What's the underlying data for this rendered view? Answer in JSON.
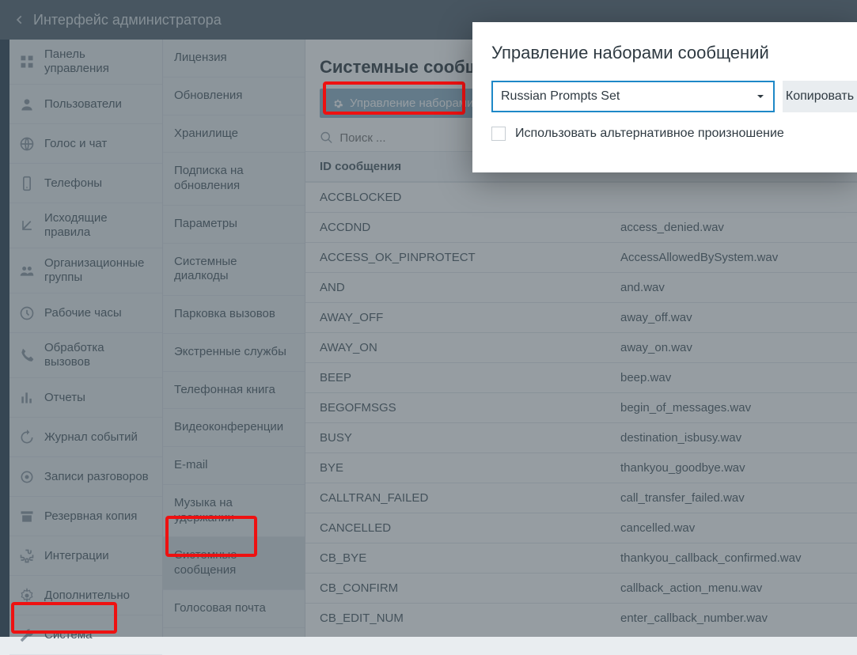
{
  "header": {
    "title": "Интерфейс администратора"
  },
  "nav1": [
    {
      "icon": "dashboard",
      "label": "Панель управления"
    },
    {
      "icon": "user",
      "label": "Пользователи"
    },
    {
      "icon": "globe",
      "label": "Голос и чат"
    },
    {
      "icon": "phone-device",
      "label": "Телефоны"
    },
    {
      "icon": "outbound",
      "label": "Исходящие правила"
    },
    {
      "icon": "group",
      "label": "Организационные группы"
    },
    {
      "icon": "clock",
      "label": "Рабочие часы"
    },
    {
      "icon": "phone",
      "label": "Обработка вызовов"
    },
    {
      "icon": "report",
      "label": "Отчеты"
    },
    {
      "icon": "history",
      "label": "Журнал событий"
    },
    {
      "icon": "record",
      "label": "Записи разговоров"
    },
    {
      "icon": "archive",
      "label": "Резервная копия"
    },
    {
      "icon": "puzzle",
      "label": "Интеграции"
    },
    {
      "icon": "gear",
      "label": "Дополнительно"
    },
    {
      "icon": "wrench",
      "label": "Система"
    }
  ],
  "nav2": [
    "Лицензия",
    "Обновления",
    "Хранилище",
    "Подписка на обновления",
    "Параметры",
    "Системные диалкоды",
    "Парковка вызовов",
    "Экстренные службы",
    "Телефонная книга",
    "Видеоконференции",
    "E-mail",
    "Музыка на удержании",
    "Системные сообщения",
    "Голосовая почта"
  ],
  "nav2_active_index": 12,
  "main": {
    "title": "Системные сообщения",
    "manage_button": "Управление наборами",
    "search_placeholder": "Поиск ...",
    "columns": [
      "ID сообщения",
      ""
    ],
    "rows": [
      {
        "id": "ACCBLOCKED",
        "file": ""
      },
      {
        "id": "ACCDND",
        "file": "access_denied.wav"
      },
      {
        "id": "ACCESS_OK_PINPROTECT",
        "file": "AccessAllowedBySystem.wav"
      },
      {
        "id": "AND",
        "file": "and.wav"
      },
      {
        "id": "AWAY_OFF",
        "file": "away_off.wav"
      },
      {
        "id": "AWAY_ON",
        "file": "away_on.wav"
      },
      {
        "id": "BEEP",
        "file": "beep.wav"
      },
      {
        "id": "BEGOFMSGS",
        "file": "begin_of_messages.wav"
      },
      {
        "id": "BUSY",
        "file": "destination_isbusy.wav"
      },
      {
        "id": "BYE",
        "file": "thankyou_goodbye.wav"
      },
      {
        "id": "CALLTRAN_FAILED",
        "file": "call_transfer_failed.wav"
      },
      {
        "id": "CANCELLED",
        "file": "cancelled.wav"
      },
      {
        "id": "CB_BYE",
        "file": "thankyou_callback_confirmed.wav"
      },
      {
        "id": "CB_CONFIRM",
        "file": "callback_action_menu.wav"
      },
      {
        "id": "CB_EDIT_NUM",
        "file": "enter_callback_number.wav"
      }
    ]
  },
  "modal": {
    "title": "Управление наборами сообщений",
    "selected_set": "Russian Prompts Set",
    "copy_label": "Копировать",
    "checkbox_label": "Использовать альтернативное произношение"
  }
}
